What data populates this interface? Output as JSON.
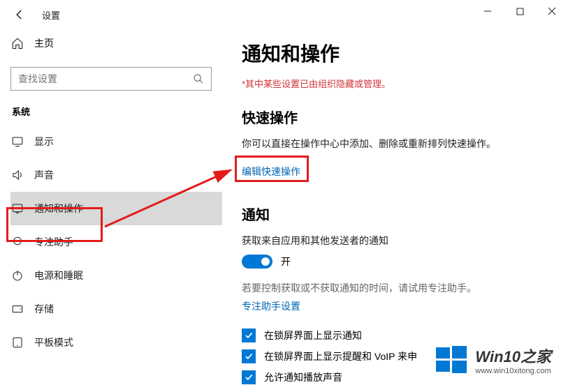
{
  "window": {
    "title": "设置"
  },
  "sidebar": {
    "home": "主页",
    "search_placeholder": "查找设置",
    "section": "系统",
    "items": [
      {
        "label": "显示"
      },
      {
        "label": "声音"
      },
      {
        "label": "通知和操作"
      },
      {
        "label": "专注助手"
      },
      {
        "label": "电源和睡眠"
      },
      {
        "label": "存储"
      },
      {
        "label": "平板模式"
      }
    ]
  },
  "main": {
    "title": "通知和操作",
    "warning": "*其中某些设置已由组织隐藏或管理。",
    "quick_actions_heading": "快速操作",
    "quick_actions_desc": "你可以直接在操作中心中添加、删除或重新排列快速操作。",
    "edit_link": "编辑快速操作",
    "notifications_heading": "通知",
    "notif_desc": "获取来自应用和其他发送者的通知",
    "toggle_state": "开",
    "focus_hint": "若要控制获取或不获取通知的时间，请试用专注助手。",
    "focus_link": "专注助手设置",
    "checks": [
      "在锁屏界面上显示通知",
      "在锁屏界面上显示提醒和 VoIP 来申",
      "允许通知播放声音"
    ]
  },
  "watermark": {
    "brand": "Win10之家",
    "url": "www.win10xitong.com"
  }
}
